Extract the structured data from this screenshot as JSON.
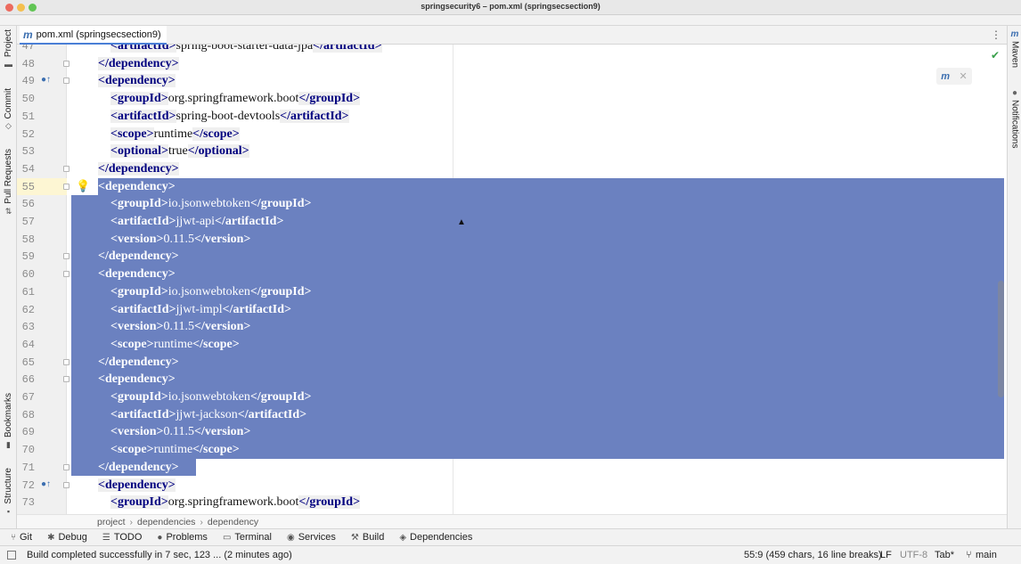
{
  "window": {
    "title": "springsecurity6 – pom.xml (springsecsection9)"
  },
  "colors": {
    "selection": "#6b81c0",
    "xml_tag": "#000080",
    "accent": "#3c6fb0"
  },
  "left_tools": [
    {
      "label": "Project",
      "icon": "folder-icon"
    },
    {
      "label": "Commit",
      "icon": "commit-icon"
    },
    {
      "label": "Pull Requests",
      "icon": "pull-request-icon"
    },
    {
      "label": "Bookmarks",
      "icon": "bookmark-icon"
    },
    {
      "label": "Structure",
      "icon": "structure-icon"
    }
  ],
  "right_tools": [
    {
      "label": "Maven",
      "icon": "maven-icon"
    },
    {
      "label": "Notifications",
      "icon": "bell-icon"
    }
  ],
  "editor_tab": {
    "icon": "m",
    "label": "pom.xml (springsecsection9)"
  },
  "editor": {
    "line_numbers": [
      "47",
      "48",
      "49",
      "50",
      "51",
      "52",
      "53",
      "54",
      "55",
      "56",
      "57",
      "58",
      "59",
      "60",
      "61",
      "62",
      "63",
      "64",
      "65",
      "66",
      "67",
      "68",
      "69",
      "70",
      "71",
      "72",
      "73"
    ],
    "lines": [
      {
        "pre": "    ",
        "t1": "<artifactId>",
        "mid": "spring-boot-starter-data-jpa",
        "t2": "</artifactId>"
      },
      {
        "pre": "  ",
        "t1": "</dependency>",
        "mid": "",
        "t2": ""
      },
      {
        "pre": "  ",
        "t1": "<dependency>",
        "mid": "",
        "t2": ""
      },
      {
        "pre": "    ",
        "t1": "<groupId>",
        "mid": "org.springframework.boot",
        "t2": "</groupId>"
      },
      {
        "pre": "    ",
        "t1": "<artifactId>",
        "mid": "spring-boot-devtools",
        "t2": "</artifactId>"
      },
      {
        "pre": "    ",
        "t1": "<scope>",
        "mid": "runtime",
        "t2": "</scope>"
      },
      {
        "pre": "    ",
        "t1": "<optional>",
        "mid": "true",
        "t2": "</optional>"
      },
      {
        "pre": "  ",
        "t1": "</dependency>",
        "mid": "",
        "t2": ""
      },
      {
        "pre": "  ",
        "t1": "<dependency>",
        "mid": "",
        "t2": ""
      },
      {
        "pre": "    ",
        "t1": "<groupId>",
        "mid": "io.jsonwebtoken",
        "t2": "</groupId>"
      },
      {
        "pre": "    ",
        "t1": "<artifactId>",
        "mid": "jjwt-api",
        "t2": "</artifactId>"
      },
      {
        "pre": "    ",
        "t1": "<version>",
        "mid": "0.11.5",
        "t2": "</version>"
      },
      {
        "pre": "  ",
        "t1": "</dependency>",
        "mid": "",
        "t2": ""
      },
      {
        "pre": "  ",
        "t1": "<dependency>",
        "mid": "",
        "t2": ""
      },
      {
        "pre": "    ",
        "t1": "<groupId>",
        "mid": "io.jsonwebtoken",
        "t2": "</groupId>"
      },
      {
        "pre": "    ",
        "t1": "<artifactId>",
        "mid": "jjwt-impl",
        "t2": "</artifactId>"
      },
      {
        "pre": "    ",
        "t1": "<version>",
        "mid": "0.11.5",
        "t2": "</version>"
      },
      {
        "pre": "    ",
        "t1": "<scope>",
        "mid": "runtime",
        "t2": "</scope>"
      },
      {
        "pre": "  ",
        "t1": "</dependency>",
        "mid": "",
        "t2": ""
      },
      {
        "pre": "  ",
        "t1": "<dependency>",
        "mid": "",
        "t2": ""
      },
      {
        "pre": "    ",
        "t1": "<groupId>",
        "mid": "io.jsonwebtoken",
        "t2": "</groupId>"
      },
      {
        "pre": "    ",
        "t1": "<artifactId>",
        "mid": "jjwt-jackson",
        "t2": "</artifactId>"
      },
      {
        "pre": "    ",
        "t1": "<version>",
        "mid": "0.11.5",
        "t2": "</version>"
      },
      {
        "pre": "    ",
        "t1": "<scope>",
        "mid": "runtime",
        "t2": "</scope>"
      },
      {
        "pre": "  ",
        "t1": "</dependency>",
        "mid": "",
        "t2": ""
      },
      {
        "pre": "  ",
        "t1": "<dependency>",
        "mid": "",
        "t2": ""
      },
      {
        "pre": "    ",
        "t1": "<groupId>",
        "mid": "org.springframework.boot",
        "t2": "</groupId>"
      }
    ],
    "selection_lines": [
      "55",
      "71"
    ],
    "current_line": "55"
  },
  "breadcrumb": [
    "project",
    "dependencies",
    "dependency"
  ],
  "tool_windows": [
    {
      "label": "Git",
      "icon": "git-icon"
    },
    {
      "label": "Debug",
      "icon": "debug-icon"
    },
    {
      "label": "TODO",
      "icon": "todo-icon"
    },
    {
      "label": "Problems",
      "icon": "problems-icon"
    },
    {
      "label": "Terminal",
      "icon": "terminal-icon"
    },
    {
      "label": "Services",
      "icon": "services-icon"
    },
    {
      "label": "Build",
      "icon": "build-icon"
    },
    {
      "label": "Dependencies",
      "icon": "dependencies-icon"
    }
  ],
  "status": {
    "message": "Build completed successfully in 7 sec, 123 ... (2 minutes ago)",
    "position": "55:9 (459 chars, 16 line breaks)",
    "line_sep": "LF",
    "encoding": "UTF-8",
    "indent": "Tab*",
    "branch": "main"
  }
}
